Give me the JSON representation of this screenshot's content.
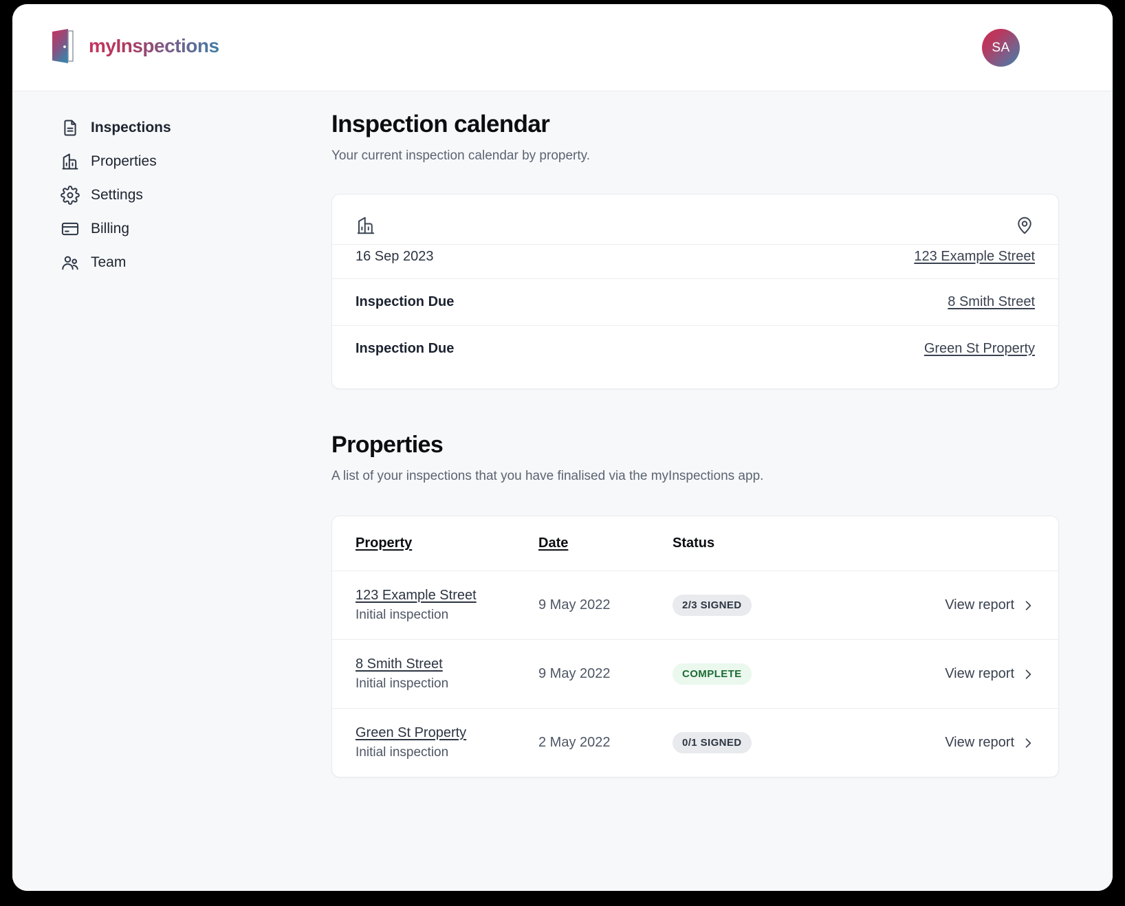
{
  "brand": {
    "name": "myInspections",
    "logo_icon": "open-door-icon",
    "gradient_start": "#c9325c",
    "gradient_end": "#3f7fa8"
  },
  "header": {
    "avatar_initials": "SA"
  },
  "sidebar": {
    "items": [
      {
        "label": "Inspections",
        "icon": "document-icon",
        "active": true
      },
      {
        "label": "Properties",
        "icon": "building-icon",
        "active": false
      },
      {
        "label": "Settings",
        "icon": "gear-icon",
        "active": false
      },
      {
        "label": "Billing",
        "icon": "credit-card-icon",
        "active": false
      },
      {
        "label": "Team",
        "icon": "users-icon",
        "active": false
      }
    ]
  },
  "calendar_section": {
    "title": "Inspection calendar",
    "subtitle": "Your current inspection calendar by property.",
    "card_icons": {
      "left": "building-icon",
      "right": "map-pin-icon"
    },
    "rows": [
      {
        "left": "16 Sep 2023",
        "bold": false,
        "link": "123 Example Street"
      },
      {
        "left": "Inspection Due",
        "bold": true,
        "link": "8 Smith Street"
      },
      {
        "left": "Inspection Due",
        "bold": true,
        "link": "Green St Property"
      }
    ]
  },
  "properties_section": {
    "title": "Properties",
    "subtitle": "A list of your inspections that you have finalised via the myInspections app.",
    "columns": [
      {
        "label": "Property",
        "sortable": true
      },
      {
        "label": "Date",
        "sortable": true
      },
      {
        "label": "Status",
        "sortable": false
      }
    ],
    "action_label": "View report",
    "action_icon": "chevron-right-icon",
    "rows": [
      {
        "property": "123 Example Street",
        "inspection_type": "Initial inspection",
        "date": "9 May 2022",
        "status": "2/3 SIGNED",
        "status_style": "gray"
      },
      {
        "property": "8 Smith Street",
        "inspection_type": "Initial inspection",
        "date": "9 May 2022",
        "status": "COMPLETE",
        "status_style": "green"
      },
      {
        "property": "Green St Property",
        "inspection_type": "Initial inspection",
        "date": "2 May 2022",
        "status": "0/1 SIGNED",
        "status_style": "gray"
      }
    ]
  }
}
